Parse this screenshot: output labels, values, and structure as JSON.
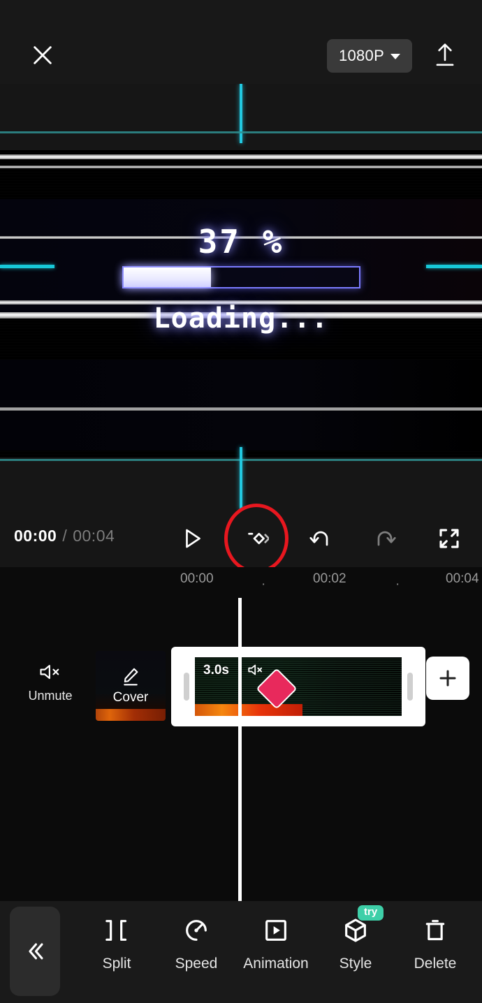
{
  "topbar": {
    "close_icon": "close-icon",
    "resolution": "1080P",
    "caret_icon": "chevron-down-icon",
    "export_icon": "upload-icon"
  },
  "preview": {
    "percent_text": "37 %",
    "progress_value": 37,
    "loading_text": "Loading...",
    "accent_cyan": "#22c8e0",
    "guide_teal": "#2f8f91",
    "bar_border": "#7b7bff"
  },
  "player": {
    "current_time": "00:00",
    "separator": "/",
    "total_time": "00:04",
    "play_icon": "play-icon",
    "keyframe_icon": "keyframe-icon",
    "undo_icon": "undo-icon",
    "redo_icon": "redo-icon",
    "fullscreen_icon": "fullscreen-icon",
    "highlight_color": "#e8171f"
  },
  "timeline": {
    "ruler_marks": [
      "00:00",
      "00:02",
      "00:04"
    ],
    "ruler_dot": "·",
    "unmute": {
      "label": "Unmute",
      "icon": "speaker-muted-icon"
    },
    "cover": {
      "label": "Cover",
      "icon": "pencil-icon"
    },
    "clip": {
      "duration": "3.0s",
      "mute_icon": "speaker-muted-icon",
      "keyframe_marker": "keyframe-diamond",
      "keyframe_color": "#e8295c"
    },
    "add_button_icon": "plus-icon"
  },
  "toolbar": {
    "collapse_icon": "chevron-double-left-icon",
    "items": [
      {
        "label": "Split",
        "icon": "split-icon",
        "badge": ""
      },
      {
        "label": "Speed",
        "icon": "speed-icon",
        "badge": ""
      },
      {
        "label": "Animation",
        "icon": "animation-icon",
        "badge": ""
      },
      {
        "label": "Style",
        "icon": "style-cube-icon",
        "badge": "try"
      },
      {
        "label": "Delete",
        "icon": "trash-icon",
        "badge": ""
      }
    ],
    "badge_color": "#3ecfa8"
  }
}
